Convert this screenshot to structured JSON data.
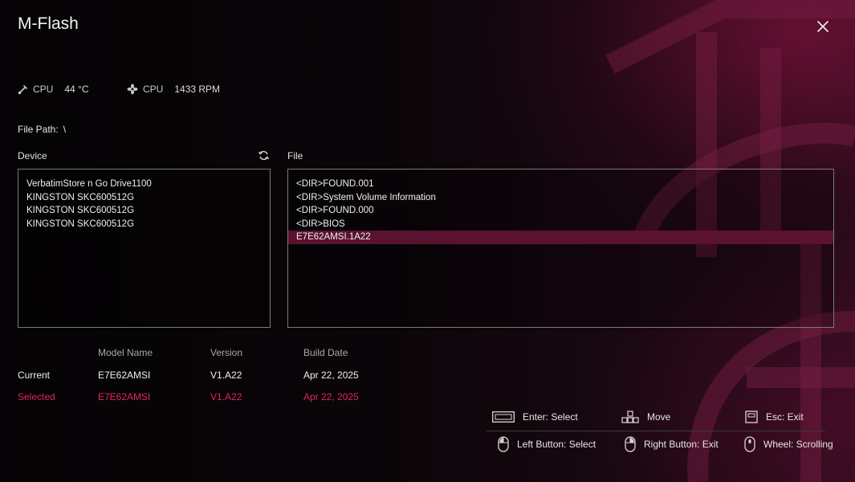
{
  "app": {
    "title": "M-Flash"
  },
  "hardware": {
    "cpu_temp": {
      "label": "CPU",
      "value": "44 °C"
    },
    "cpu_fan": {
      "label": "CPU",
      "value": "1433 RPM"
    }
  },
  "file_path": {
    "label": "File Path:",
    "value": "\\"
  },
  "device_panel": {
    "label": "Device",
    "items": [
      "VerbatimStore n Go Drive1100",
      "KINGSTON SKC600512G",
      "KINGSTON SKC600512G",
      "KINGSTON SKC600512G"
    ]
  },
  "file_panel": {
    "label": "File",
    "items": [
      "<DIR>FOUND.001",
      "<DIR>System Volume Information",
      "<DIR>FOUND.000",
      "<DIR>BIOS",
      "E7E62AMSI.1A22"
    ],
    "selected_index": 4
  },
  "bios_info": {
    "headers": [
      "Model Name",
      "Version",
      "Build Date"
    ],
    "current": {
      "label": "Current",
      "model": "E7E62AMSI",
      "version": "V1.A22",
      "date": "Apr 22, 2025"
    },
    "selected": {
      "label": "Selected",
      "model": "E7E62AMSI",
      "version": "V1.A22",
      "date": "Apr 22, 2025"
    }
  },
  "key_hints": {
    "enter": "Enter: Select",
    "move": "Move",
    "esc": "Esc: Exit",
    "left_button": "Left Button: Select",
    "right_button": "Right Button: Exit",
    "wheel": "Wheel: Scrolling"
  },
  "colors": {
    "accent": "#e0245e",
    "selection": "#5a1230",
    "background": "#0a0508"
  }
}
